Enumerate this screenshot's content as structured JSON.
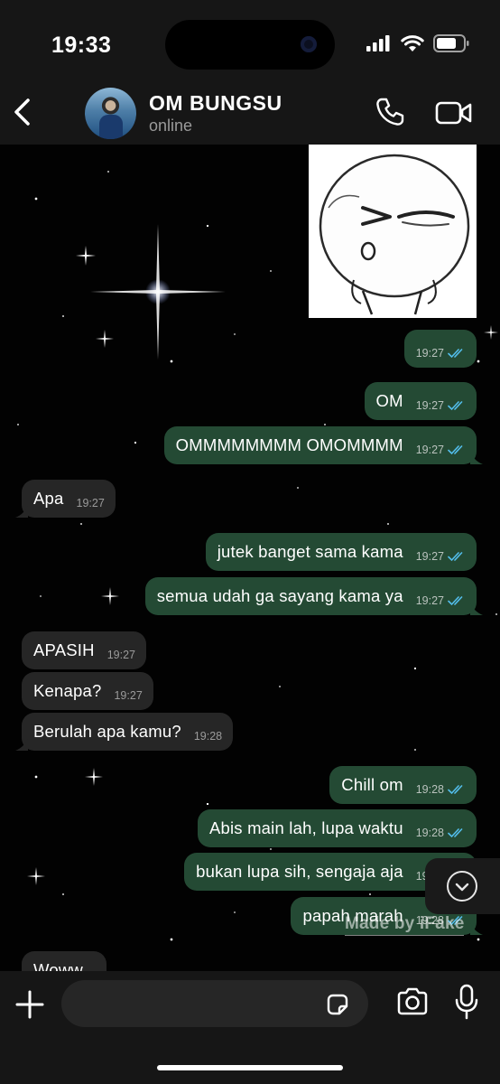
{
  "status_bar": {
    "time": "19:33"
  },
  "header": {
    "contact_name": "OM BUNGSU",
    "contact_status": "online"
  },
  "messages": [
    {
      "dir": "out",
      "text": "",
      "time": "19:27",
      "ticks": true
    },
    {
      "dir": "out",
      "text": "OM",
      "time": "19:27",
      "ticks": true
    },
    {
      "dir": "out",
      "text": "OMMMMMMMM OMOMMMM",
      "time": "19:27",
      "ticks": true
    },
    {
      "dir": "in",
      "text": "Apa",
      "time": "19:27"
    },
    {
      "dir": "out",
      "text": "jutek banget sama kama",
      "time": "19:27",
      "ticks": true
    },
    {
      "dir": "out",
      "text": "semua udah ga sayang kama ya",
      "time": "19:27",
      "ticks": true
    },
    {
      "dir": "in",
      "text": "APASIH",
      "time": "19:27"
    },
    {
      "dir": "in",
      "text": "Kenapa?",
      "time": "19:27"
    },
    {
      "dir": "in",
      "text": "Berulah apa kamu?",
      "time": "19:28"
    },
    {
      "dir": "out",
      "text": "Chill om",
      "time": "19:28",
      "ticks": true
    },
    {
      "dir": "out",
      "text": "Abis main lah, lupa waktu",
      "time": "19:28",
      "ticks": true
    },
    {
      "dir": "out",
      "text": "bukan lupa sih, sengaja aja",
      "time": "19:28",
      "ticks": true
    },
    {
      "dir": "out",
      "text": "papah marah",
      "time": "19:28",
      "ticks": true
    },
    {
      "dir": "in",
      "text": "Woww",
      "time": ""
    }
  ],
  "watermark": "Made by iFake",
  "composer": {
    "placeholder": ""
  },
  "colors": {
    "outgoing_bubble": "#244a34",
    "incoming_bubble": "#262626",
    "read_ticks": "#53bdeb",
    "bar_bg": "#161616"
  },
  "icons": [
    "back-chevron-icon",
    "phone-icon",
    "video-call-icon",
    "plus-icon",
    "sticker-icon",
    "camera-icon",
    "microphone-icon",
    "chevron-down-icon"
  ]
}
